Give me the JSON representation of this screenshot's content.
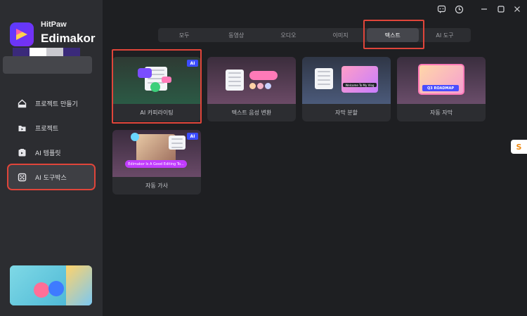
{
  "brand": {
    "top": "HitPaw",
    "name": "Edimakor"
  },
  "account_stripe_colors": [
    "#3a2a7a",
    "#ffffff",
    "#c9c9cf",
    "#3a2a7a"
  ],
  "sidebar": {
    "items": [
      {
        "label": "프로젝트 만들기",
        "icon": "home-icon",
        "active": false
      },
      {
        "label": "프로젝트",
        "icon": "folder-icon",
        "active": false
      },
      {
        "label": "AI 템플릿",
        "icon": "template-icon",
        "active": false
      },
      {
        "label": "AI 도구박스",
        "icon": "toolbox-icon",
        "active": true
      }
    ]
  },
  "window_controls": [
    "feedback-icon",
    "history-icon",
    "minimize-icon",
    "maximize-icon",
    "close-icon"
  ],
  "tabs": [
    {
      "label": "모두",
      "active": false
    },
    {
      "label": "동영상",
      "active": false
    },
    {
      "label": "오디오",
      "active": false
    },
    {
      "label": "이미지",
      "active": false
    },
    {
      "label": "텍스트",
      "active": true
    },
    {
      "label": "AI 도구",
      "active": false
    }
  ],
  "cards": [
    {
      "label": "AI 카피라이팅",
      "badge": "AI"
    },
    {
      "label": "텍스트 음성 변환",
      "badge": ""
    },
    {
      "label": "자막 분할",
      "badge": "",
      "caption": "Welcome To My Vlog"
    },
    {
      "label": "자동 자막",
      "badge": "",
      "caption": "Q3 ROADMAP"
    },
    {
      "label": "자동 가사",
      "badge": "AI",
      "caption": "Edimakor Is A Good Editing To..."
    }
  ],
  "side_chip": "S",
  "colors": {
    "accent": "#3b4cff",
    "highlight": "#e0453a",
    "sidebar": "#2c2d31",
    "bg": "#1e1f22"
  }
}
